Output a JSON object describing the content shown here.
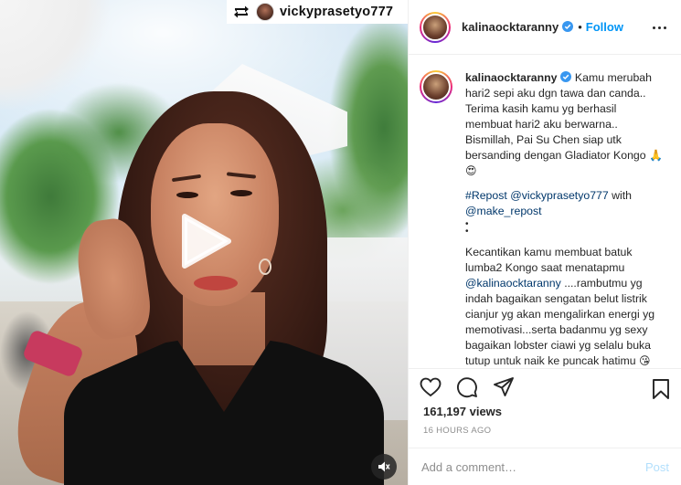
{
  "media": {
    "repost_banner": {
      "icon": "repost-icon",
      "username": "vickyprasetyo777"
    },
    "play_icon": "play-icon",
    "mute_icon": "speaker-muted-icon"
  },
  "post_header": {
    "username": "kalinaocktaranny",
    "verified_icon": "verified-badge-icon",
    "separator": "•",
    "follow_label": "Follow",
    "more_icon": "more-options-icon"
  },
  "caption": {
    "username": "kalinaocktaranny",
    "text": "Kamu merubah hari2 sepi aku dgn tawa dan canda.. Terima kasih kamu yg berhasil membuat hari2 aku berwarna.. Bismillah, Pai Su Chen siap utk bersanding dengan Gladiator Kongo",
    "emojis_1": "🙏😍",
    "repost_tag": "#Repost",
    "repost_user": "@vickyprasetyo777",
    "with_text": "with",
    "make_repost": "@make_repost",
    "dots": "•\n•",
    "para2_a": "Kecantikan kamu membuat batuk lumba2 Kongo saat menatapmu",
    "para2_mention": "@kalinaocktaranny",
    "para2_b": "....rambutmu yg indah bagaikan sengatan belut listrik cianjur yg akan mengalirkan energi yg memotivasi...serta badanmu yg sexy bagaikan lobster ciawi yg selalu buka tutup untuk naik ke puncak hatimu",
    "emojis_2": "😘",
    "emojis_3": "😘😘❤❤❤"
  },
  "actions": {
    "like_icon": "heart-icon",
    "comment_icon": "comment-icon",
    "share_icon": "share-icon",
    "save_icon": "bookmark-icon"
  },
  "stats": {
    "views": "161,197 views",
    "timestamp": "16 HOURS AGO"
  },
  "comment_box": {
    "placeholder": "Add a comment…",
    "post_label": "Post"
  },
  "colors": {
    "accent": "#0095f6",
    "post_disabled": "#b2dffc",
    "wristband": "#c73a5e"
  }
}
